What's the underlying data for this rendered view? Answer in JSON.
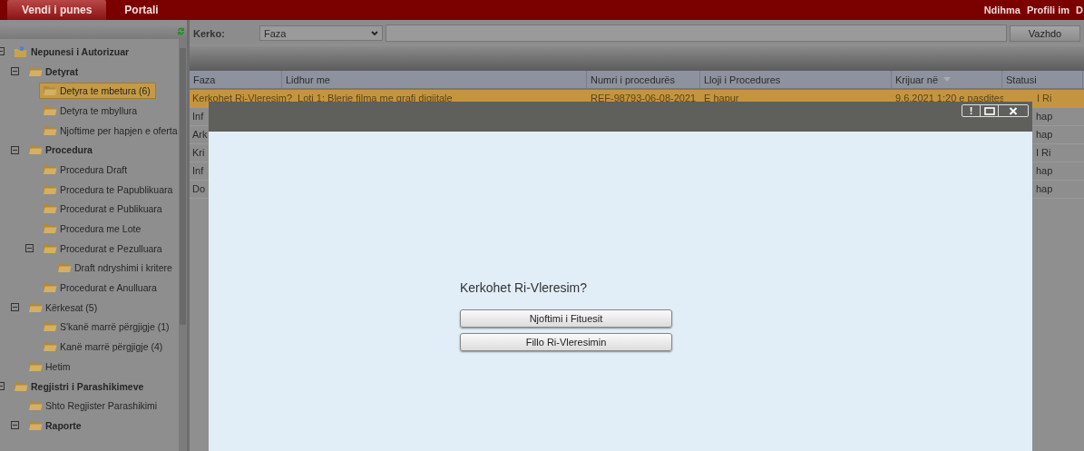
{
  "top_bar": {
    "tabs": [
      {
        "label": "Vendi i punes",
        "selected": true
      },
      {
        "label": "Portali",
        "selected": false
      }
    ],
    "links": [
      "Ndihma",
      "Profili im",
      "D"
    ]
  },
  "sidebar": {
    "tree": [
      {
        "label": "Nepunesi i Autorizuar",
        "bold": true,
        "expanded": true,
        "selected": false,
        "children": [
          {
            "label": "Detyrat",
            "bold": true,
            "expanded": true,
            "selected": false,
            "children": [
              {
                "label": "Detyra te mbetura (6)",
                "bold": false,
                "selected": true
              },
              {
                "label": "Detyra te mbyllura",
                "bold": false,
                "selected": false
              },
              {
                "label": "Njoftime per hapjen e oferta",
                "bold": false,
                "selected": false
              }
            ]
          },
          {
            "label": "Procedura",
            "bold": true,
            "expanded": true,
            "selected": false,
            "children": [
              {
                "label": "Procedura Draft",
                "bold": false,
                "selected": false
              },
              {
                "label": "Procedura te Papublikuara",
                "bold": false,
                "selected": false
              },
              {
                "label": "Procedurat e Publikuara",
                "bold": false,
                "selected": false
              },
              {
                "label": "Procedura me Lote",
                "bold": false,
                "selected": false
              },
              {
                "label": "Procedurat e Pezulluara",
                "bold": false,
                "expanded": true,
                "selected": false,
                "children": [
                  {
                    "label": "Draft ndryshimi i kritere",
                    "bold": false,
                    "selected": false
                  }
                ]
              },
              {
                "label": "Procedurat e Anulluara",
                "bold": false,
                "selected": false
              }
            ]
          },
          {
            "label": "Kërkesat (5)",
            "bold": false,
            "expanded": true,
            "selected": false,
            "children": [
              {
                "label": "S'kanë marrë përgjigje (1)",
                "bold": false,
                "selected": false
              },
              {
                "label": "Kanë marrë përgjigje (4)",
                "bold": false,
                "selected": false
              }
            ]
          },
          {
            "label": "Hetim",
            "bold": false,
            "selected": false
          }
        ]
      },
      {
        "label": "Regjistri i Parashikimeve",
        "bold": true,
        "expanded": true,
        "selected": false,
        "children": [
          {
            "label": "Shto Regjister Parashikimi",
            "bold": false,
            "selected": false
          },
          {
            "label": "Raporte",
            "bold": true,
            "expanded": true,
            "selected": false
          }
        ]
      }
    ]
  },
  "search": {
    "label": "Kerko:",
    "field": "Faza",
    "button": "Vazhdo"
  },
  "table": {
    "columns": [
      "Faza",
      "Lidhur me",
      "Numri i procedurës",
      "Lloji i Procedures",
      "Krijuar në",
      "Statusi"
    ],
    "rows": [
      {
        "selected": true,
        "cells": [
          "Kerkohet Ri-Vleresim?",
          "Loti 1: Blerje filma me grafi digjitale",
          "REF-98793-06-08-2021",
          "E hapur",
          "9.6.2021 1:20 e pasdites",
          "I Ri"
        ]
      },
      {
        "selected": false,
        "cells": [
          "Inf",
          "",
          "",
          "",
          "",
          "hap"
        ]
      },
      {
        "selected": false,
        "cells": [
          "Ark",
          "",
          "",
          "",
          "",
          "hap"
        ]
      },
      {
        "selected": false,
        "cells": [
          "Kri",
          "",
          "",
          "",
          "",
          "I Ri"
        ]
      },
      {
        "selected": false,
        "cells": [
          "Inf",
          "",
          "",
          "",
          "",
          "hap"
        ]
      },
      {
        "selected": false,
        "cells": [
          "Do",
          "",
          "",
          "",
          "",
          "hap"
        ]
      }
    ]
  },
  "dialog": {
    "info_button": "!",
    "question": "Kerkohet Ri-Vleresim?",
    "buttons": [
      "Njoftimi i Fituesit",
      "Fillo Ri-Vleresimin"
    ]
  }
}
